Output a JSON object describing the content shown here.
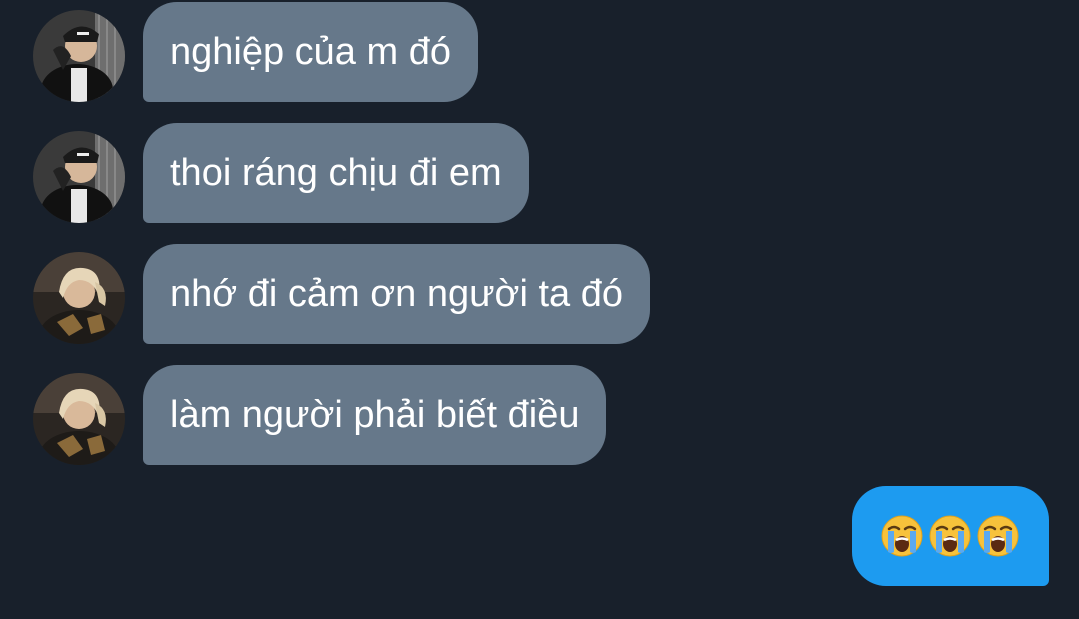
{
  "conversation": {
    "messages": [
      {
        "sender": "contact-a",
        "text": "nghiệp của m đó"
      },
      {
        "sender": "contact-a",
        "text": "thoi ráng chịu đi em"
      },
      {
        "sender": "contact-b",
        "text": "nhớ đi cảm ơn người ta đó"
      },
      {
        "sender": "contact-b",
        "text": "làm người phải biết điều"
      },
      {
        "sender": "self",
        "emoji": [
          "loudly-crying-face-icon",
          "loudly-crying-face-icon",
          "loudly-crying-face-icon"
        ]
      }
    ]
  },
  "colors": {
    "background": "#18202b",
    "incoming_bubble": "#66788a",
    "outgoing_bubble": "#1d9bf0",
    "text": "#ffffff"
  }
}
